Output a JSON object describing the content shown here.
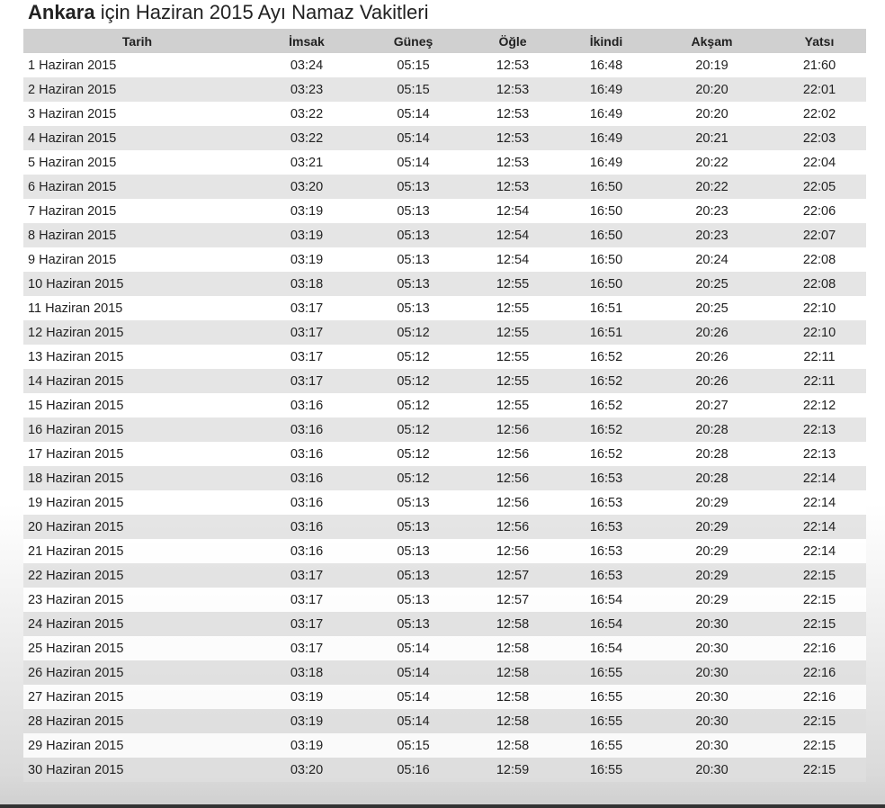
{
  "page": {
    "title_city": "Ankara",
    "title_rest": " için Haziran 2015 Ayı Namaz Vakitleri"
  },
  "table": {
    "headers": {
      "date": "Tarih",
      "imsak": "İmsak",
      "gunes": "Güneş",
      "ogle": "Öğle",
      "ikindi": "İkindi",
      "aksam": "Akşam",
      "yatsi": "Yatsı"
    },
    "rows": [
      {
        "date": "1 Haziran 2015",
        "imsak": "03:24",
        "gunes": "05:15",
        "ogle": "12:53",
        "ikindi": "16:48",
        "aksam": "20:19",
        "yatsi": "21:60"
      },
      {
        "date": "2 Haziran 2015",
        "imsak": "03:23",
        "gunes": "05:15",
        "ogle": "12:53",
        "ikindi": "16:49",
        "aksam": "20:20",
        "yatsi": "22:01"
      },
      {
        "date": "3 Haziran 2015",
        "imsak": "03:22",
        "gunes": "05:14",
        "ogle": "12:53",
        "ikindi": "16:49",
        "aksam": "20:20",
        "yatsi": "22:02"
      },
      {
        "date": "4 Haziran 2015",
        "imsak": "03:22",
        "gunes": "05:14",
        "ogle": "12:53",
        "ikindi": "16:49",
        "aksam": "20:21",
        "yatsi": "22:03"
      },
      {
        "date": "5 Haziran 2015",
        "imsak": "03:21",
        "gunes": "05:14",
        "ogle": "12:53",
        "ikindi": "16:49",
        "aksam": "20:22",
        "yatsi": "22:04"
      },
      {
        "date": "6 Haziran 2015",
        "imsak": "03:20",
        "gunes": "05:13",
        "ogle": "12:53",
        "ikindi": "16:50",
        "aksam": "20:22",
        "yatsi": "22:05"
      },
      {
        "date": "7 Haziran 2015",
        "imsak": "03:19",
        "gunes": "05:13",
        "ogle": "12:54",
        "ikindi": "16:50",
        "aksam": "20:23",
        "yatsi": "22:06"
      },
      {
        "date": "8 Haziran 2015",
        "imsak": "03:19",
        "gunes": "05:13",
        "ogle": "12:54",
        "ikindi": "16:50",
        "aksam": "20:23",
        "yatsi": "22:07"
      },
      {
        "date": "9 Haziran 2015",
        "imsak": "03:19",
        "gunes": "05:13",
        "ogle": "12:54",
        "ikindi": "16:50",
        "aksam": "20:24",
        "yatsi": "22:08"
      },
      {
        "date": "10 Haziran 2015",
        "imsak": "03:18",
        "gunes": "05:13",
        "ogle": "12:55",
        "ikindi": "16:50",
        "aksam": "20:25",
        "yatsi": "22:08"
      },
      {
        "date": "11 Haziran 2015",
        "imsak": "03:17",
        "gunes": "05:13",
        "ogle": "12:55",
        "ikindi": "16:51",
        "aksam": "20:25",
        "yatsi": "22:10"
      },
      {
        "date": "12 Haziran 2015",
        "imsak": "03:17",
        "gunes": "05:12",
        "ogle": "12:55",
        "ikindi": "16:51",
        "aksam": "20:26",
        "yatsi": "22:10"
      },
      {
        "date": "13 Haziran 2015",
        "imsak": "03:17",
        "gunes": "05:12",
        "ogle": "12:55",
        "ikindi": "16:52",
        "aksam": "20:26",
        "yatsi": "22:11"
      },
      {
        "date": "14 Haziran 2015",
        "imsak": "03:17",
        "gunes": "05:12",
        "ogle": "12:55",
        "ikindi": "16:52",
        "aksam": "20:26",
        "yatsi": "22:11"
      },
      {
        "date": "15 Haziran 2015",
        "imsak": "03:16",
        "gunes": "05:12",
        "ogle": "12:55",
        "ikindi": "16:52",
        "aksam": "20:27",
        "yatsi": "22:12"
      },
      {
        "date": "16 Haziran 2015",
        "imsak": "03:16",
        "gunes": "05:12",
        "ogle": "12:56",
        "ikindi": "16:52",
        "aksam": "20:28",
        "yatsi": "22:13"
      },
      {
        "date": "17 Haziran 2015",
        "imsak": "03:16",
        "gunes": "05:12",
        "ogle": "12:56",
        "ikindi": "16:52",
        "aksam": "20:28",
        "yatsi": "22:13"
      },
      {
        "date": "18 Haziran 2015",
        "imsak": "03:16",
        "gunes": "05:12",
        "ogle": "12:56",
        "ikindi": "16:53",
        "aksam": "20:28",
        "yatsi": "22:14"
      },
      {
        "date": "19 Haziran 2015",
        "imsak": "03:16",
        "gunes": "05:13",
        "ogle": "12:56",
        "ikindi": "16:53",
        "aksam": "20:29",
        "yatsi": "22:14"
      },
      {
        "date": "20 Haziran 2015",
        "imsak": "03:16",
        "gunes": "05:13",
        "ogle": "12:56",
        "ikindi": "16:53",
        "aksam": "20:29",
        "yatsi": "22:14"
      },
      {
        "date": "21 Haziran 2015",
        "imsak": "03:16",
        "gunes": "05:13",
        "ogle": "12:56",
        "ikindi": "16:53",
        "aksam": "20:29",
        "yatsi": "22:14"
      },
      {
        "date": "22 Haziran 2015",
        "imsak": "03:17",
        "gunes": "05:13",
        "ogle": "12:57",
        "ikindi": "16:53",
        "aksam": "20:29",
        "yatsi": "22:15"
      },
      {
        "date": "23 Haziran 2015",
        "imsak": "03:17",
        "gunes": "05:13",
        "ogle": "12:57",
        "ikindi": "16:54",
        "aksam": "20:29",
        "yatsi": "22:15"
      },
      {
        "date": "24 Haziran 2015",
        "imsak": "03:17",
        "gunes": "05:13",
        "ogle": "12:58",
        "ikindi": "16:54",
        "aksam": "20:30",
        "yatsi": "22:15"
      },
      {
        "date": "25 Haziran 2015",
        "imsak": "03:17",
        "gunes": "05:14",
        "ogle": "12:58",
        "ikindi": "16:54",
        "aksam": "20:30",
        "yatsi": "22:16"
      },
      {
        "date": "26 Haziran 2015",
        "imsak": "03:18",
        "gunes": "05:14",
        "ogle": "12:58",
        "ikindi": "16:55",
        "aksam": "20:30",
        "yatsi": "22:16"
      },
      {
        "date": "27 Haziran 2015",
        "imsak": "03:19",
        "gunes": "05:14",
        "ogle": "12:58",
        "ikindi": "16:55",
        "aksam": "20:30",
        "yatsi": "22:16"
      },
      {
        "date": "28 Haziran 2015",
        "imsak": "03:19",
        "gunes": "05:14",
        "ogle": "12:58",
        "ikindi": "16:55",
        "aksam": "20:30",
        "yatsi": "22:15"
      },
      {
        "date": "29 Haziran 2015",
        "imsak": "03:19",
        "gunes": "05:15",
        "ogle": "12:58",
        "ikindi": "16:55",
        "aksam": "20:30",
        "yatsi": "22:15"
      },
      {
        "date": "30 Haziran 2015",
        "imsak": "03:20",
        "gunes": "05:16",
        "ogle": "12:59",
        "ikindi": "16:55",
        "aksam": "20:30",
        "yatsi": "22:15"
      }
    ]
  },
  "colors": {
    "header_bg": "#d0d0d0",
    "row_alt_bg": "#dfdfdf",
    "text": "#222222"
  }
}
